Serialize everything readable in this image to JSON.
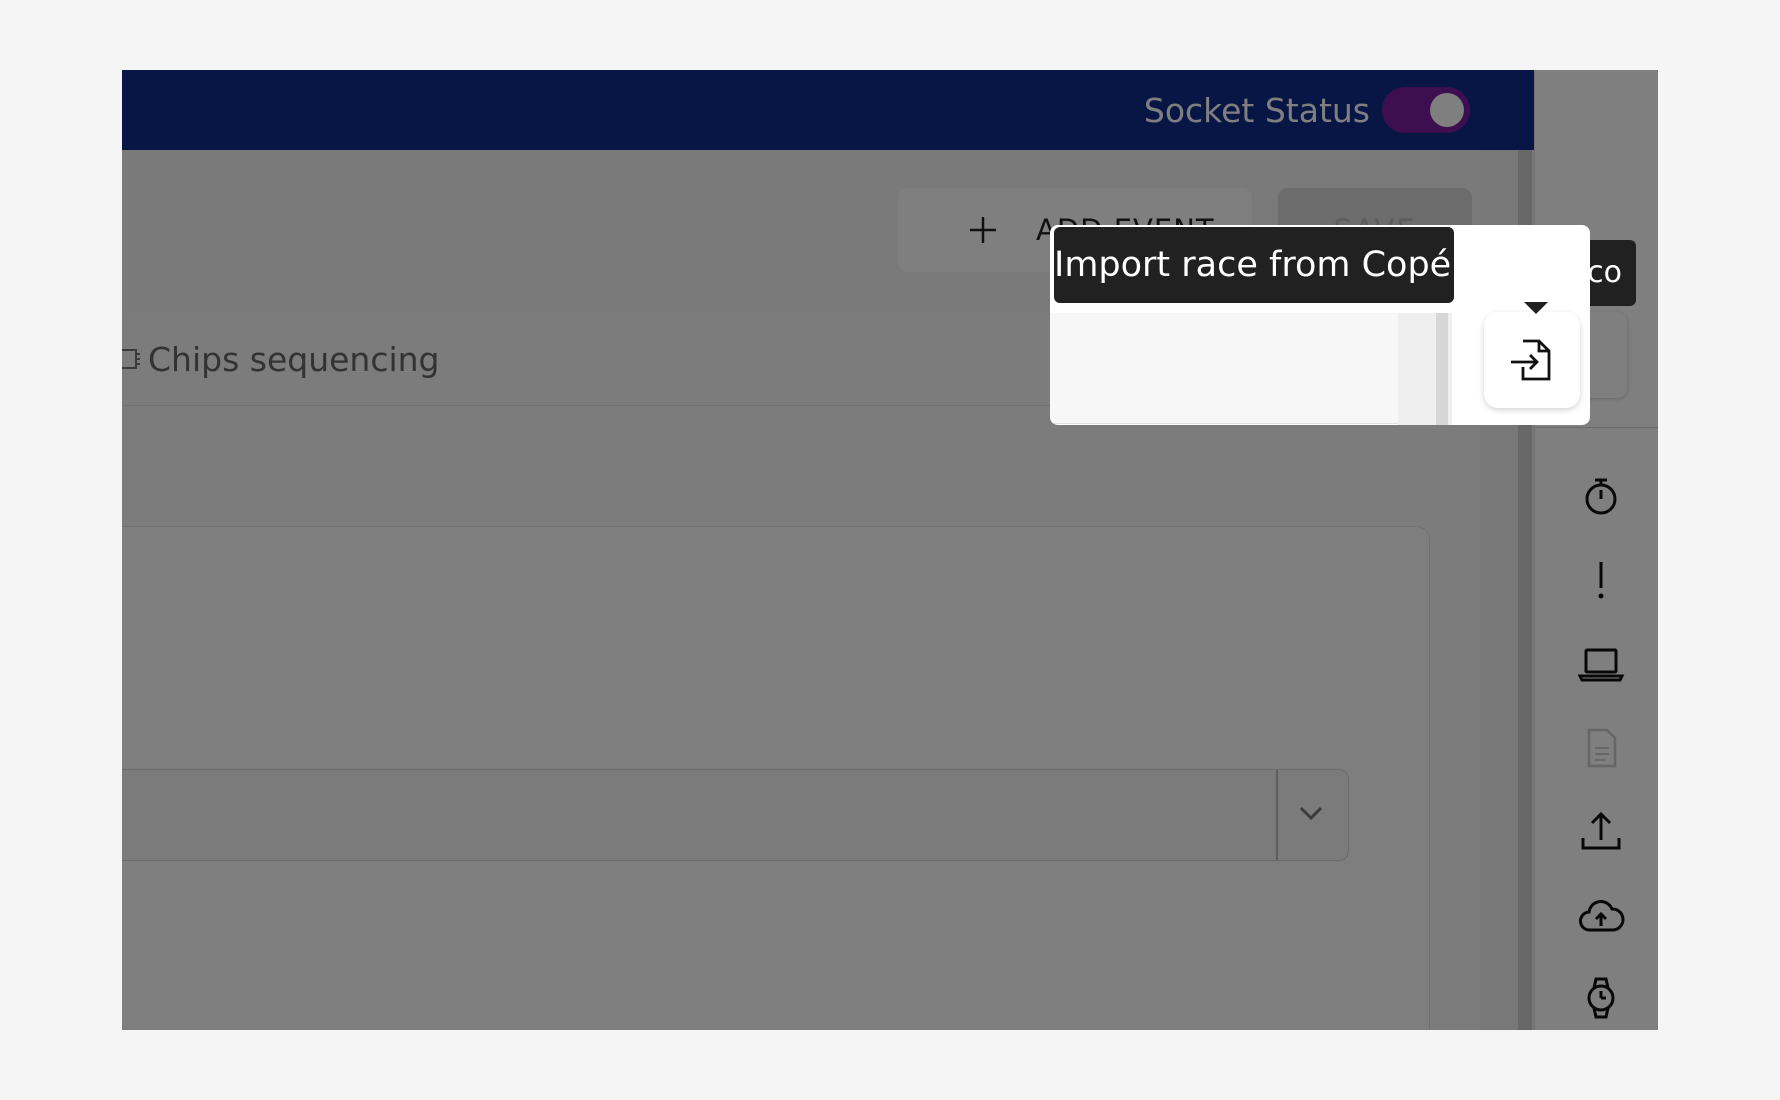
{
  "header": {
    "socket_status_label": "Socket Status",
    "socket_toggle_on": true
  },
  "toolbar": {
    "add_event_label": "ADD EVENT",
    "save_label": "SAVE"
  },
  "tabs": {
    "chips_label": "Chips sequencing"
  },
  "sidebar": {
    "icons": [
      "import-file-icon",
      "stopwatch-icon",
      "exclamation-icon",
      "laptop-icon",
      "document-icon",
      "upload-tray-icon",
      "cloud-upload-icon",
      "watch-icon"
    ]
  },
  "tooltip": {
    "text": "Import race from Copérnico",
    "behind_text": "co"
  },
  "colors": {
    "header_bg": "#0f2c88",
    "toggle_on": "#7b1fa2",
    "tooltip_bg": "#212121"
  }
}
